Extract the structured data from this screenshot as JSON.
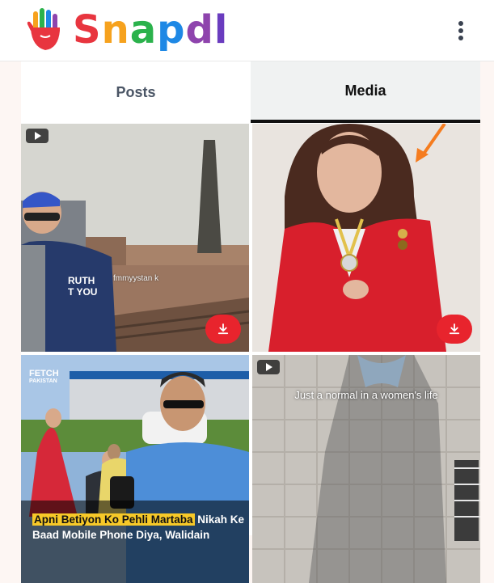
{
  "app": {
    "logo_text": "Snapdl",
    "logo_letters": [
      {
        "ch": "S",
        "color": "#e8353f"
      },
      {
        "ch": "n",
        "color": "#f6a21e"
      },
      {
        "ch": "a",
        "color": "#2bb24c"
      },
      {
        "ch": "p",
        "color": "#1e88e5"
      },
      {
        "ch": "d",
        "color": "#8e44ad"
      },
      {
        "ch": "l",
        "color": "#6a3cbf"
      }
    ]
  },
  "tabs": [
    {
      "label": "Posts",
      "active": false
    },
    {
      "label": "Media",
      "active": true
    }
  ],
  "media": [
    {
      "type": "video",
      "watermark": "fmmyystan k",
      "download": true
    },
    {
      "type": "image",
      "download": true
    },
    {
      "type": "image",
      "brand_main": "FETCH",
      "brand_sub": "PAKISTAN",
      "caption_highlight": "Apni Betiyon Ko Pehli Martaba",
      "caption_rest": " Nikah Ke Baad Mobile Phone Diya, Walidain",
      "download": false
    },
    {
      "type": "video",
      "caption": "Just a normal in a women's life",
      "download": false
    }
  ],
  "colors": {
    "accent_download": "#e8242d",
    "annotation_arrow": "#f57c1f"
  },
  "icons": {
    "menu": "kebab-menu-icon",
    "download": "download-icon",
    "play": "video-play-icon"
  }
}
